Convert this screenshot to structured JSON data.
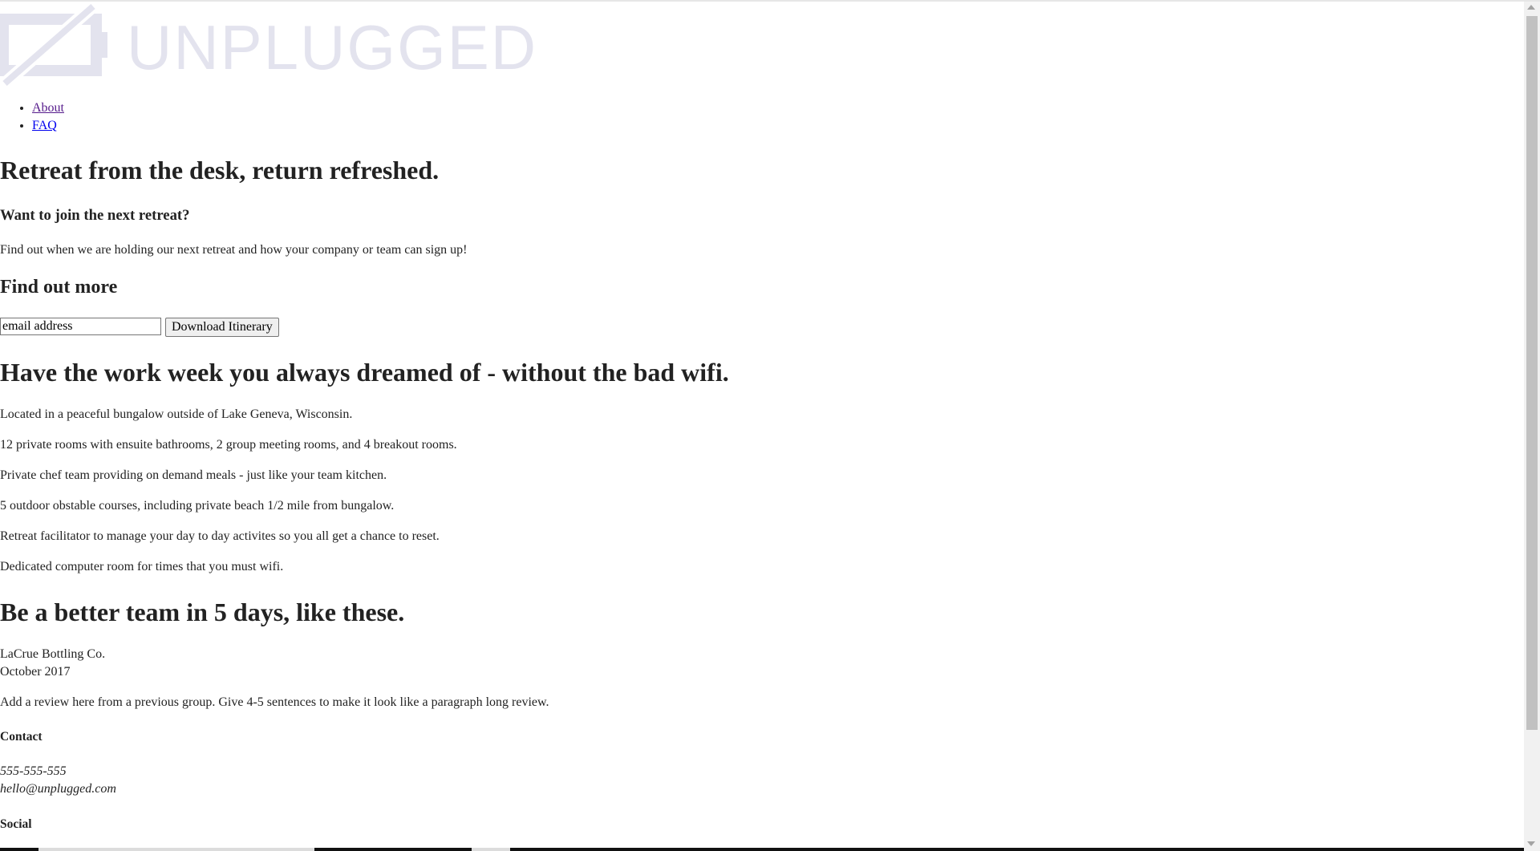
{
  "logo": {
    "brand": "UNPLUGGED",
    "icon": "unplugged-battery-icon"
  },
  "nav": {
    "items": [
      {
        "label": "About"
      },
      {
        "label": "FAQ"
      }
    ]
  },
  "hero": {
    "title": "Retreat from the desk, return refreshed.",
    "subtitle": "Want to join the next retreat?",
    "text": "Find out when we are holding our next retreat and how your company or team can sign up!"
  },
  "signup": {
    "heading": "Find out more",
    "email_placeholder": "email address",
    "email_value": "email address",
    "button_label": "Download Itinerary"
  },
  "features": {
    "heading": "Have the work week you always dreamed of - without the bad wifi.",
    "items": [
      "Located in a peaceful bungalow outside of Lake Geneva, Wisconsin.",
      "12 private rooms with ensuite bathrooms, 2 group meeting rooms, and 4 breakout rooms.",
      "Private chef team providing on demand meals - just like your team kitchen.",
      "5 outdoor obstable courses, including private beach 1/2 mile from bungalow.",
      "Retreat facilitator to manage your day to day activites so you all get a chance to reset.",
      "Dedicated computer room for times that you must wifi."
    ]
  },
  "testimonials": {
    "heading": "Be a better team in 5 days, like these.",
    "company": "LaCrue Bottling Co.",
    "date": "October 2017",
    "review": "Add a review here from a previous group. Give 4-5 sentences to make it look like a paragraph long review."
  },
  "contact": {
    "heading": "Contact",
    "phone": "555-555-555",
    "email": "hello@unplugged.com"
  },
  "social": {
    "heading": "Social"
  },
  "colors": {
    "logo": "#e3e3ee",
    "link": "#0000ee",
    "visited_link": "#551a8b",
    "text": "#222222"
  }
}
